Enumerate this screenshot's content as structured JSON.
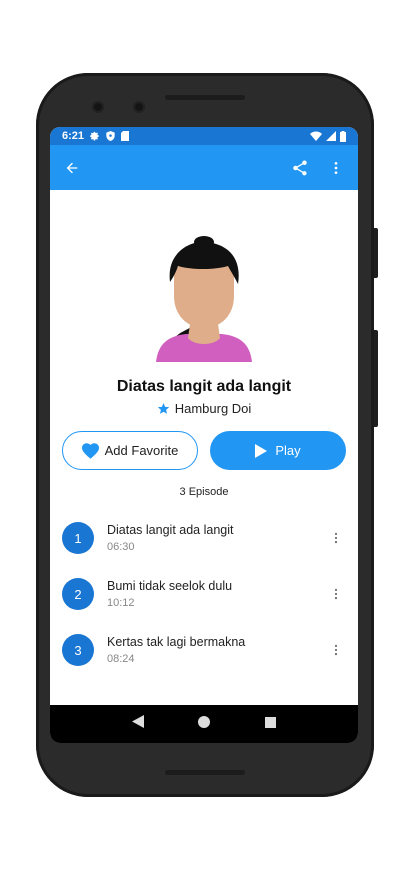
{
  "status_bar": {
    "time": "6:21"
  },
  "book": {
    "title": "Diatas langit ada langit",
    "author": "Hamburg Doi"
  },
  "actions": {
    "favorite_label": "Add Favorite",
    "play_label": "Play"
  },
  "episode_count": "3 Episode",
  "episodes": [
    {
      "number": "1",
      "title": "Diatas langit ada langit",
      "duration": "06:30"
    },
    {
      "number": "2",
      "title": "Bumi tidak seelok dulu",
      "duration": "10:12"
    },
    {
      "number": "3",
      "title": "Kertas tak lagi bermakna",
      "duration": "08:24"
    }
  ],
  "colors": {
    "primary": "#2196f3",
    "primary_dark": "#1976d2",
    "avatar_shirt": "#d15fbf",
    "avatar_skin": "#e0ad8a",
    "avatar_hair": "#111111"
  },
  "icons": {
    "back": "arrow-left-icon",
    "share": "share-icon",
    "menu": "more-vert-icon",
    "favorite": "heart-icon",
    "play": "play-icon",
    "author": "star-icon"
  }
}
